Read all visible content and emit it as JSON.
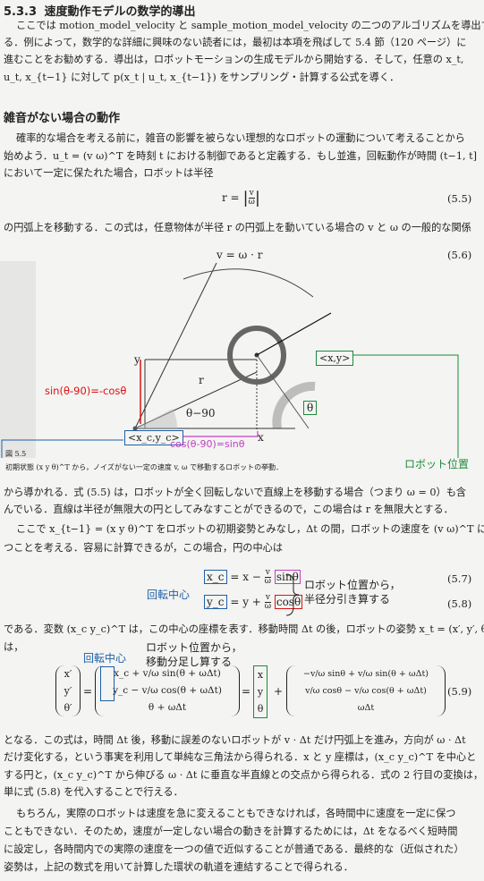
{
  "section": {
    "number": "5.3.3",
    "title": "速度動作モデルの数学的導出"
  },
  "intro": {
    "lines": [
      "ここでは motion_model_velocity と sample_motion_model_velocity の二つのアルゴリズムを導出す",
      "る．例によって，数学的な詳細に興味のない読者には，最初は本項を飛ばして 5.4 節（120 ページ）に",
      "進むことをお勧めする．導出は，ロボットモーションの生成モデルから開始する．そして，任意の x_t,",
      "u_t, x_{t−1} に対して p(x_t | u_t, x_{t−1}) をサンプリング・計算する公式を導く．"
    ]
  },
  "subsection": {
    "title": "雑音がない場合の動作"
  },
  "para2": {
    "lines": [
      "確率的な場合を考える前に，雑音の影響を被らない理想的なロボットの運動について考えることから",
      "始めよう．u_t = (v ω)^T を時刻 t における制御であると定義する．もし並進，回転動作が時間 (t−1, t]",
      "において一定に保たれた場合，ロボットは半径"
    ]
  },
  "eq55": {
    "lhs": "r =",
    "num": "v",
    "den": "ω",
    "number": "(5.5)"
  },
  "para3": {
    "line": "の円弧上を移動する．この式は，任意物体が半径 r の円弧上を動いている場合の v と ω の一般的な関係"
  },
  "eq56": {
    "text": "v = ω · r",
    "number": "(5.6)"
  },
  "figure": {
    "label_y": "y",
    "label_x": "x",
    "label_r": "r",
    "label_angle": "θ−90",
    "label_theta": "θ",
    "label_center": "<x_c,y_c>",
    "label_robot": "<x,y>",
    "annot_sin": "sin(θ-90)=-cosθ",
    "annot_cos": "cos(θ-90)=sinθ",
    "annot_robot_pos": "ロボット位置",
    "caption_num": "図 5.5",
    "caption_text": "初期状態 (x y θ)^T から，ノイズがない一定の速度 v, ω で移動するロボットの挙動．"
  },
  "para4": {
    "lines": [
      "から導かれる．式 (5.5) は，ロボットが全く回転しないで直線上を移動する場合（つまり ω = 0）も含",
      "んでいる．直線は半径が無限大の円としてみなすことができるので，この場合は r を無限大とする．",
      "ここで x_{t−1} = (x y θ)^T をロボットの初期姿勢とみなし，Δt の間，ロボットの速度を (v ω)^T に保",
      "つことを考える．容易に計算できるが，この場合，円の中心は"
    ]
  },
  "eq57": {
    "lhs": "x_c",
    "rhs": "= x −",
    "num": "v",
    "den": "ω",
    "fn": "sinθ",
    "number": "(5.7)"
  },
  "eq58": {
    "lhs": "y_c",
    "rhs": "= y +",
    "num": "v",
    "den": "ω",
    "fn": "cosθ",
    "number": "(5.8)"
  },
  "annot_center": "回転中心",
  "annot_radius": [
    "ロボット位置から，",
    "半径分引き算する"
  ],
  "para5": {
    "lines": [
      "である．変数 (x_c y_c)^T は，この中心の座標を表す．移動時間 Δt の後，ロボットの姿勢 x_t = (x′, y′, θ′)^T",
      "は，"
    ]
  },
  "annot_center2": "回転中心",
  "annot_move": [
    "ロボット位置から，",
    "移動分足し算する"
  ],
  "eq59": {
    "lhs": [
      "x′",
      "y′",
      "θ′"
    ],
    "mid": [
      "x_c + v/ω sin(θ + ωΔt)",
      "y_c − v/ω cos(θ + ωΔt)",
      "θ + ωΔt"
    ],
    "vec": [
      "x",
      "y",
      "θ"
    ],
    "right": [
      "−v/ω sinθ + v/ω sin(θ + ωΔt)",
      "v/ω cosθ − v/ω cos(θ + ωΔt)",
      "ωΔt"
    ],
    "number": "(5.9)"
  },
  "para6": {
    "lines": [
      "となる．この式は，時間 Δt 後，移動に誤差のないロボットが v · Δt だけ円弧上を進み，方向が ω · Δt",
      "だけ変化する，という事実を利用して単純な三角法から得られる．x と y 座標は，(x_c y_c)^T を中心と",
      "する円と，(x_c y_c)^T から伸びる ω · Δt に垂直な半直線との交点から得られる．式の 2 行目の変換は，",
      "単に式 (5.8) を代入することで行える．",
      "もちろん，実際のロボットは速度を急に変えることもできなければ，各時間中に速度を一定に保つ",
      "こともできない．そのため，速度が一定しない場合の動きを計算するためには，Δt をなるべく短時間",
      "に設定し，各時間内での実際の速度を一つの値で近似することが普通である．最終的な（近似された）",
      "姿勢は，上記の数式を用いて計算した環状の軌道を連結することで得られる．"
    ]
  }
}
